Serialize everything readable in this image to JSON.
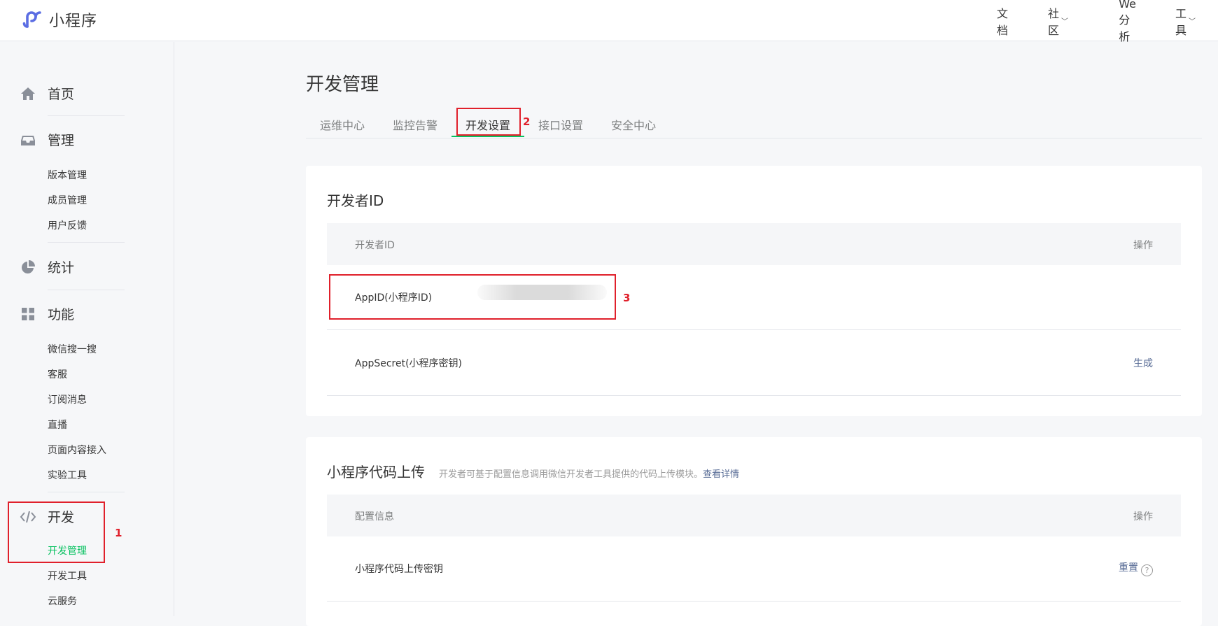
{
  "app": {
    "logo_text": "小程序"
  },
  "topnav": {
    "docs": "文档",
    "community": "社区",
    "we_analysis": "We分析",
    "tools": "工具"
  },
  "sidebar": {
    "home": "首页",
    "manage": "管理",
    "manage_items": [
      "版本管理",
      "成员管理",
      "用户反馈"
    ],
    "stats": "统计",
    "features": "功能",
    "feature_items": [
      "微信搜一搜",
      "客服",
      "订阅消息",
      "直播",
      "页面内容接入",
      "实验工具"
    ],
    "dev": "开发",
    "dev_items": [
      "开发管理",
      "开发工具",
      "云服务"
    ]
  },
  "main": {
    "title": "开发管理",
    "tabs": [
      "运维中心",
      "监控告警",
      "开发设置",
      "接口设置",
      "安全中心"
    ],
    "active_tab": "开发设置"
  },
  "developer_id_card": {
    "title": "开发者ID",
    "col_name": "开发者ID",
    "col_action": "操作",
    "rows": [
      {
        "name": "AppID(小程序ID)",
        "value": "",
        "action": ""
      },
      {
        "name": "AppSecret(小程序密钥)",
        "action": "生成"
      }
    ]
  },
  "upload_card": {
    "title": "小程序代码上传",
    "desc": "开发者可基于配置信息调用微信开发者工具提供的代码上传模块。",
    "desc_link": "查看详情",
    "col_name": "配置信息",
    "col_action": "操作",
    "rows": [
      {
        "name": "小程序代码上传密钥",
        "action": "重置",
        "help": "?"
      }
    ]
  },
  "annotations": [
    "1",
    "2",
    "3"
  ],
  "colors": {
    "accent_green": "#07c160",
    "link": "#576b95",
    "annotation_red": "#e0202b"
  }
}
